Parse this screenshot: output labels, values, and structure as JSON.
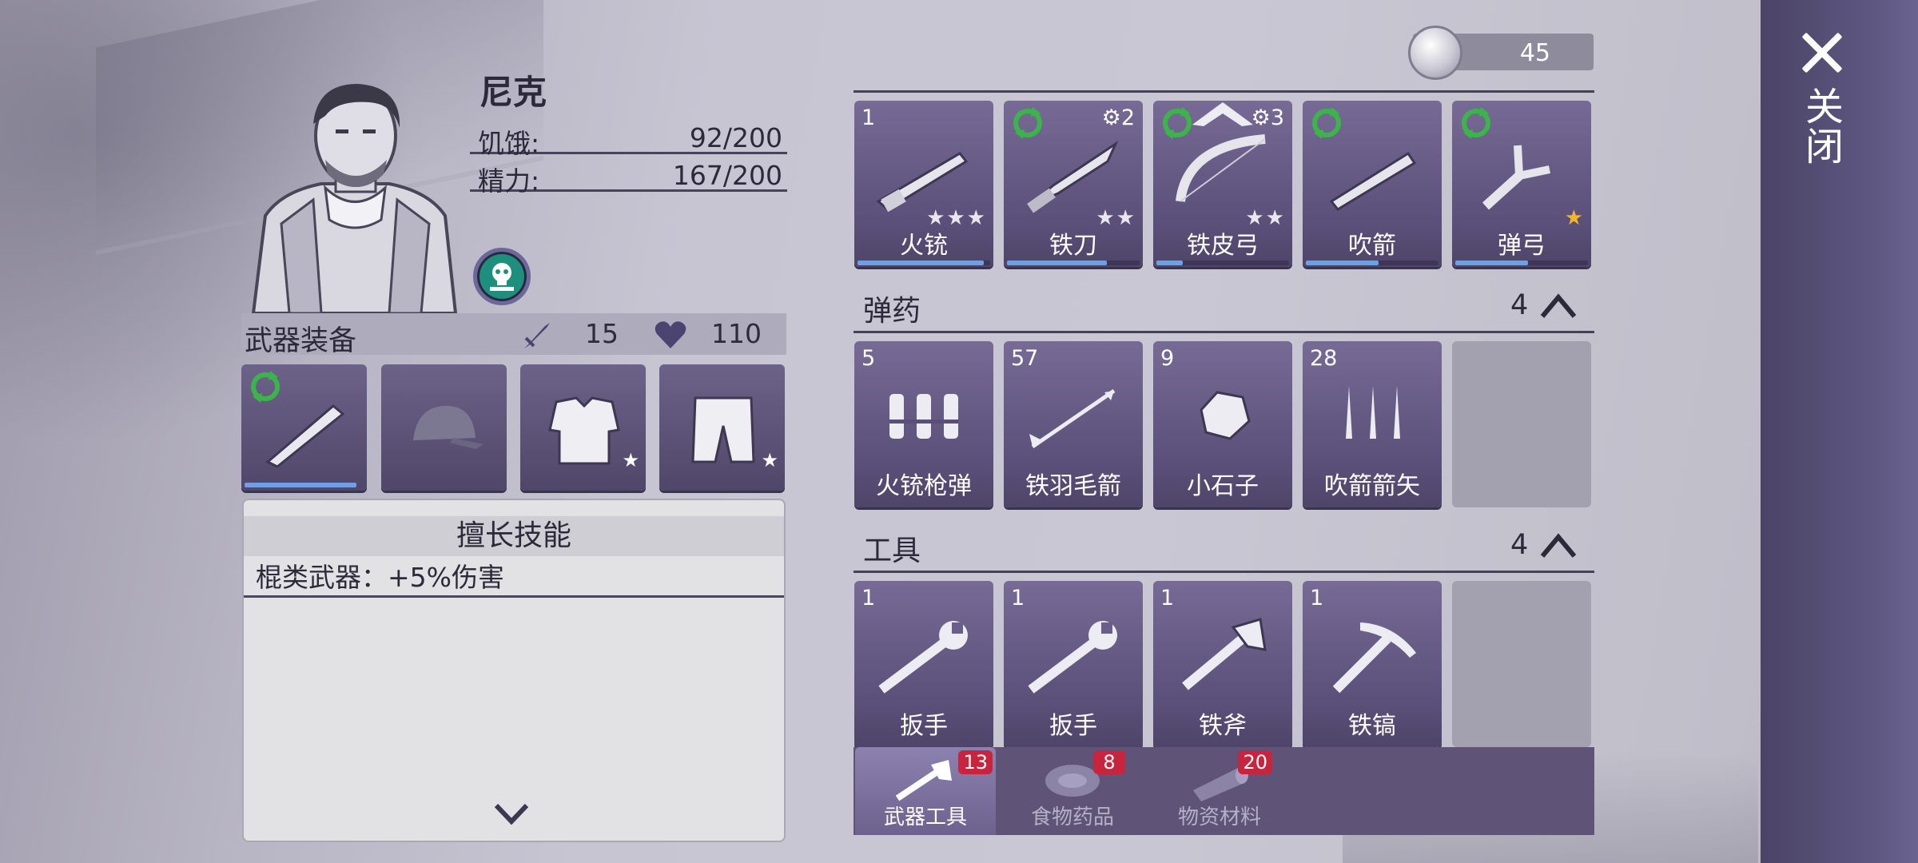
{
  "character": {
    "name": "尼克",
    "hunger_label": "饥饿:",
    "hunger_value": "92/200",
    "energy_label": "精力:",
    "energy_value": "167/200"
  },
  "equipment": {
    "title": "武器装备",
    "attack": "15",
    "health": "110"
  },
  "skills": {
    "title": "擅长技能",
    "entry": "棍类武器：+5%伤害"
  },
  "currency": {
    "amount": "45"
  },
  "close": {
    "label": "关闭"
  },
  "weapons": [
    {
      "name": "火铳",
      "count": "1",
      "stars": "★★★",
      "durability": 0.95
    },
    {
      "name": "铁刀",
      "level": "2",
      "stars": "★★",
      "durability": 0.75
    },
    {
      "name": "铁皮弓",
      "level": "3",
      "stars": "★★",
      "durability": 0.2
    },
    {
      "name": "吹箭",
      "durability": 0.55
    },
    {
      "name": "弹弓",
      "stars": "★",
      "durability": 0.55
    }
  ],
  "ammo": {
    "title": "弹药",
    "count": "4",
    "items": [
      {
        "name": "火铳枪弹",
        "count": "5"
      },
      {
        "name": "铁羽毛箭",
        "count": "57"
      },
      {
        "name": "小石子",
        "count": "9"
      },
      {
        "name": "吹箭箭矢",
        "count": "28"
      }
    ]
  },
  "tools": {
    "title": "工具",
    "count": "4",
    "items": [
      {
        "name": "扳手",
        "count": "1"
      },
      {
        "name": "扳手",
        "count": "1"
      },
      {
        "name": "铁斧",
        "count": "1"
      },
      {
        "name": "铁镐",
        "count": "1"
      }
    ]
  },
  "tabs": [
    {
      "label": "武器工具",
      "badge": "13"
    },
    {
      "label": "食物药品",
      "badge": "8"
    },
    {
      "label": "物资材料",
      "badge": "20"
    }
  ],
  "colors": {
    "panel": "#5f5478",
    "durability": "#6da0e5",
    "badge": "#c7243d",
    "refresh": "#3bb44a"
  }
}
